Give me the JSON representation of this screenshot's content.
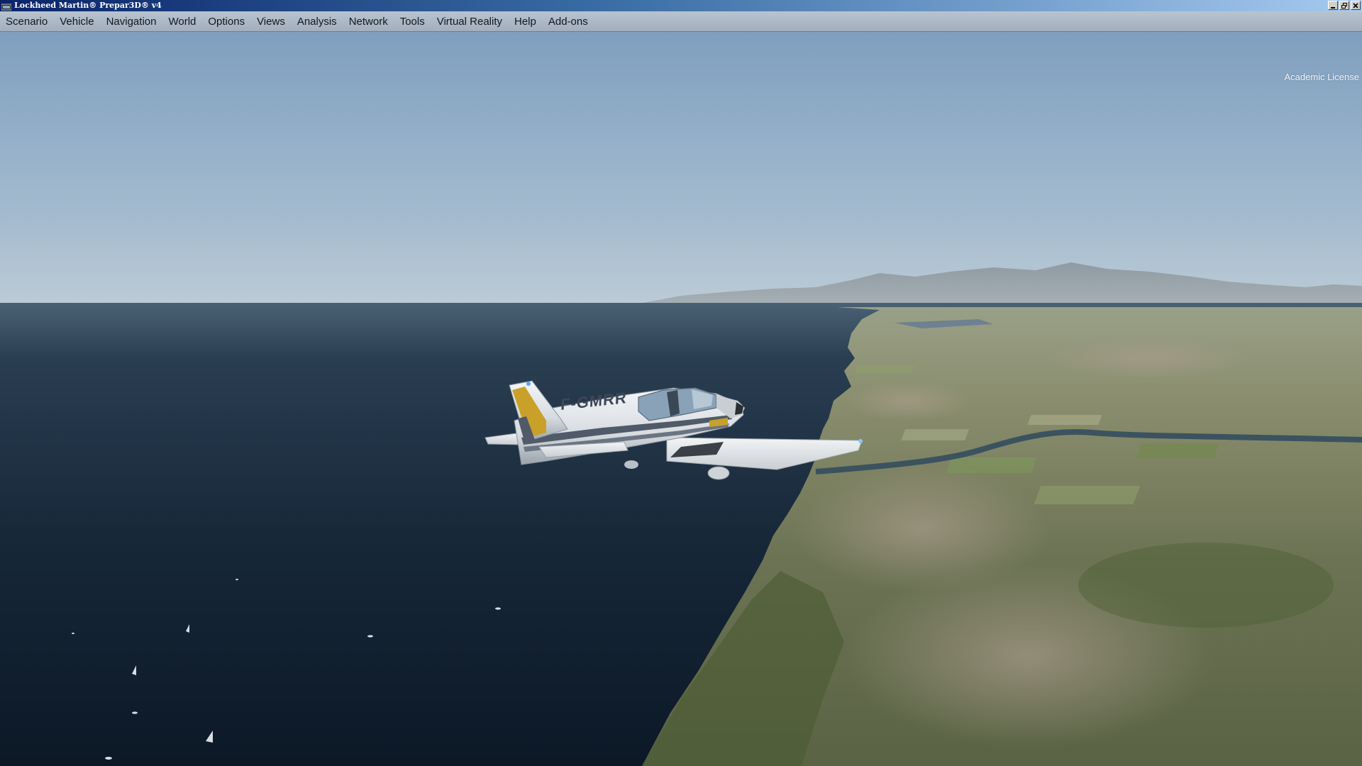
{
  "window": {
    "title": "Lockheed Martin® Prepar3D® v4",
    "app_icon": "prepar3d-logo-icon",
    "controls": [
      "minimize-icon",
      "restore-icon",
      "close-icon"
    ]
  },
  "menu": {
    "items": [
      {
        "label": "Scenario"
      },
      {
        "label": "Vehicle"
      },
      {
        "label": "Navigation"
      },
      {
        "label": "World"
      },
      {
        "label": "Options"
      },
      {
        "label": "Views"
      },
      {
        "label": "Analysis"
      },
      {
        "label": "Network"
      },
      {
        "label": "Tools"
      },
      {
        "label": "Virtual Reality"
      },
      {
        "label": "Help"
      },
      {
        "label": "Add-ons"
      }
    ]
  },
  "viewport": {
    "license_text": "Academic License",
    "aircraft_registration": "F-GMRR",
    "colors": {
      "sky_top": "#7f9fbf",
      "sky_horizon": "#b9c9d6",
      "sea_far": "#3a5066",
      "sea_near": "#0f1d2c",
      "land": "#6b7455",
      "aircraft_white": "#e8ebee",
      "aircraft_stripe_yellow": "#c9a12a"
    }
  }
}
